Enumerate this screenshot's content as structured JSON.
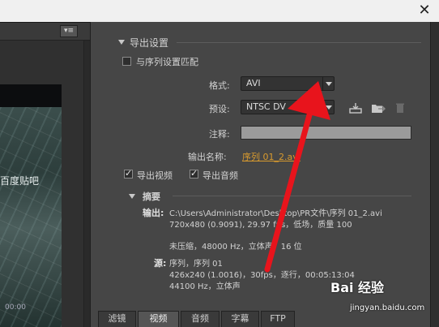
{
  "window": {
    "close_icon": "close-icon"
  },
  "preview": {
    "menu_icon": "panel-menu-icon",
    "watermark": "百度贴吧",
    "timecode": "00:00"
  },
  "export": {
    "section_title": "导出设置",
    "match_sequence_label": "与序列设置匹配",
    "match_sequence_checked": false,
    "format_label": "格式:",
    "format_value": "AVI",
    "preset_label": "预设:",
    "preset_value": "NTSC DV",
    "note_label": "注释:",
    "note_value": "",
    "output_name_label": "输出名称:",
    "output_name_value": "序列 01_2.avi",
    "export_video_label": "导出视频",
    "export_video_checked": true,
    "export_audio_label": "导出音频",
    "export_audio_checked": true
  },
  "summary": {
    "title": "摘要",
    "output_label": "输出:",
    "output_path": "C:\\Users\\Administrator\\Desktop\\PR文件\\序列 01_2.avi",
    "output_line2": "720x480 (0.9091), 29.97 fps，低场，质量 100",
    "output_line3": "未压缩，48000 Hz，立体声，16 位",
    "source_label": "源:",
    "source_line1": "序列，序列 01",
    "source_line2": "426x240 (1.0016)，30fps，逐行，00:05:13:04",
    "source_line3": "44100 Hz，立体声"
  },
  "tabs": [
    {
      "label": "滤镜"
    },
    {
      "label": "视频"
    },
    {
      "label": "音频"
    },
    {
      "label": "字幕"
    },
    {
      "label": "FTP"
    }
  ],
  "active_tab": "视频",
  "overlay": {
    "brand": "Bai 经验",
    "url": "jingyan.baidu.com"
  },
  "colors": {
    "panel_bg": "#464646",
    "link": "#d89a2e",
    "annotation_arrow": "#e8141c"
  }
}
